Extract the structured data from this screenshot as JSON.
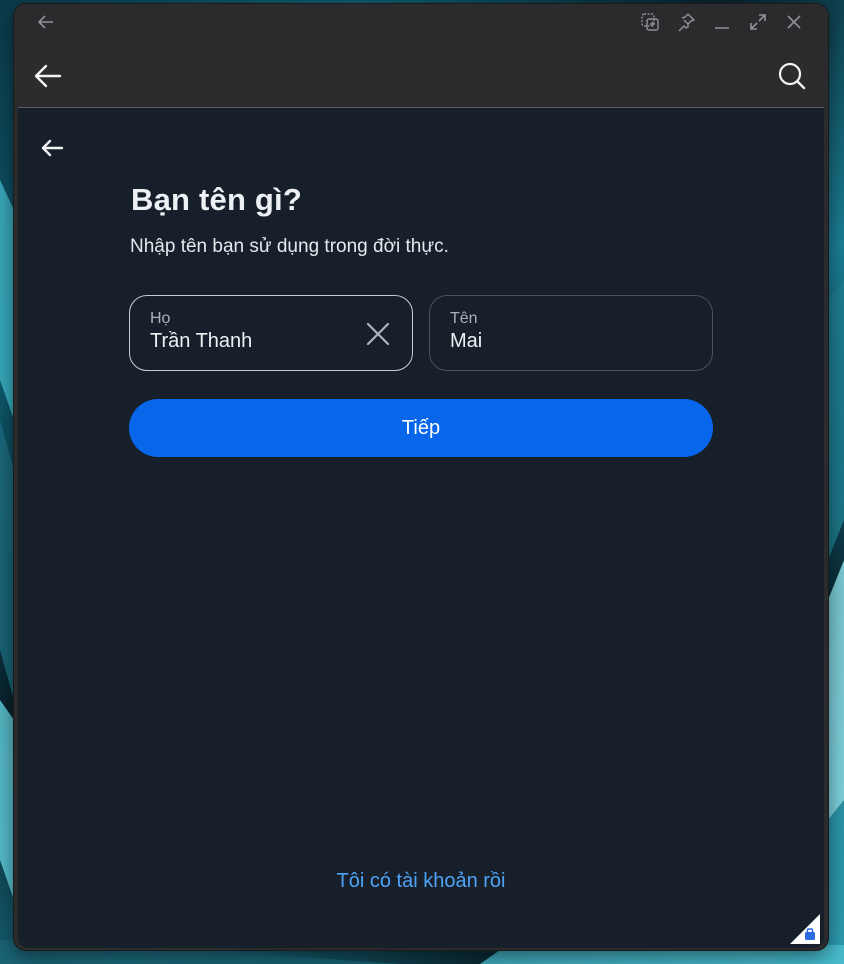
{
  "window": {
    "icons": [
      "back-arrow-icon",
      "snap-layout-icon",
      "pin-icon",
      "minimize-icon",
      "maximize-icon",
      "close-icon"
    ]
  },
  "appbar": {
    "back_icon": "arrow-left-icon",
    "search_icon": "search-icon"
  },
  "form": {
    "title": "Bạn tên gì?",
    "subtitle": "Nhập tên bạn sử dụng trong đời thực.",
    "last_name": {
      "label": "Họ",
      "value": "Trần Thanh"
    },
    "first_name": {
      "label": "Tên",
      "value": "Mai"
    },
    "next_label": "Tiếp",
    "have_account_label": "Tôi có tài khoản rồi"
  },
  "colors": {
    "accent": "#0866ea",
    "link": "#4ea3f7",
    "background": "#17202a"
  }
}
